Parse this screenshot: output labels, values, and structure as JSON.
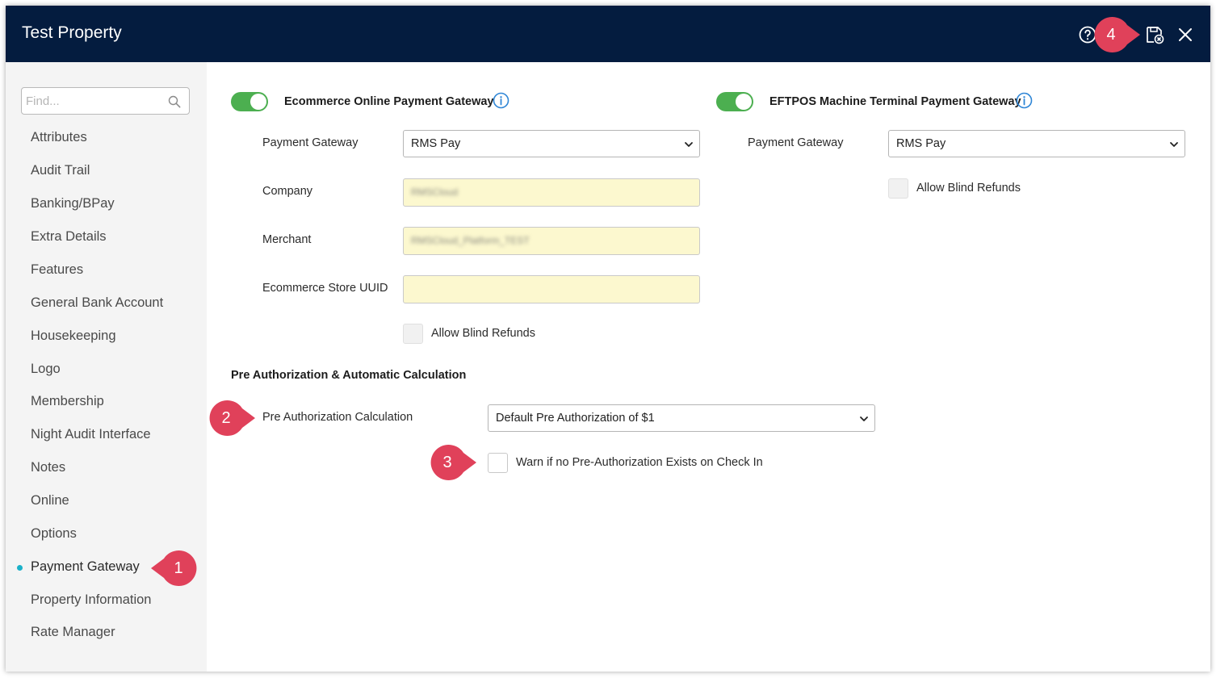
{
  "window": {
    "title": "Test Property",
    "icons": {
      "help": "help-circle-icon",
      "save": "save-close-icon",
      "close": "close-icon"
    }
  },
  "sidebar": {
    "search": {
      "placeholder": "Find...",
      "icon": "search-icon"
    },
    "items": [
      {
        "label": "Attributes"
      },
      {
        "label": "Audit Trail"
      },
      {
        "label": "Banking/BPay"
      },
      {
        "label": "Extra Details"
      },
      {
        "label": "Features"
      },
      {
        "label": "General Bank Account"
      },
      {
        "label": "Housekeeping"
      },
      {
        "label": "Logo"
      },
      {
        "label": "Membership"
      },
      {
        "label": "Night Audit Interface"
      },
      {
        "label": "Notes"
      },
      {
        "label": "Online"
      },
      {
        "label": "Options"
      },
      {
        "label": "Payment Gateway",
        "active": true
      },
      {
        "label": "Property Information"
      },
      {
        "label": "Rate Manager"
      }
    ]
  },
  "ecommerce": {
    "title": "Ecommerce Online Payment Gateway",
    "enabled": true,
    "gateway_label": "Payment Gateway",
    "gateway_value": "RMS Pay",
    "company_label": "Company",
    "company_value": "RMSCloud",
    "merchant_label": "Merchant",
    "merchant_value": "RMSCloud_Platform_TEST",
    "uuid_label": "Ecommerce Store UUID",
    "uuid_value": "",
    "blind_refunds_label": "Allow Blind Refunds"
  },
  "eftpos": {
    "title": "EFTPOS Machine Terminal Payment Gateway",
    "enabled": true,
    "gateway_label": "Payment Gateway",
    "gateway_value": "RMS Pay",
    "blind_refunds_label": "Allow Blind Refunds"
  },
  "preauth": {
    "section_title": "Pre Authorization & Automatic Calculation",
    "calc_label": "Pre Authorization Calculation",
    "calc_value": "Default Pre Authorization of $1",
    "warn_label": "Warn if no Pre-Authorization Exists on Check In"
  },
  "callouts": [
    "1",
    "2",
    "3",
    "4"
  ],
  "colors": {
    "titlebar": "#041c3f",
    "toggle_on": "#4caf50",
    "callout": "#e0415a",
    "field_fill": "#fcf8cf",
    "active_dot": "#1ab1c9",
    "info": "#2f86d6"
  }
}
